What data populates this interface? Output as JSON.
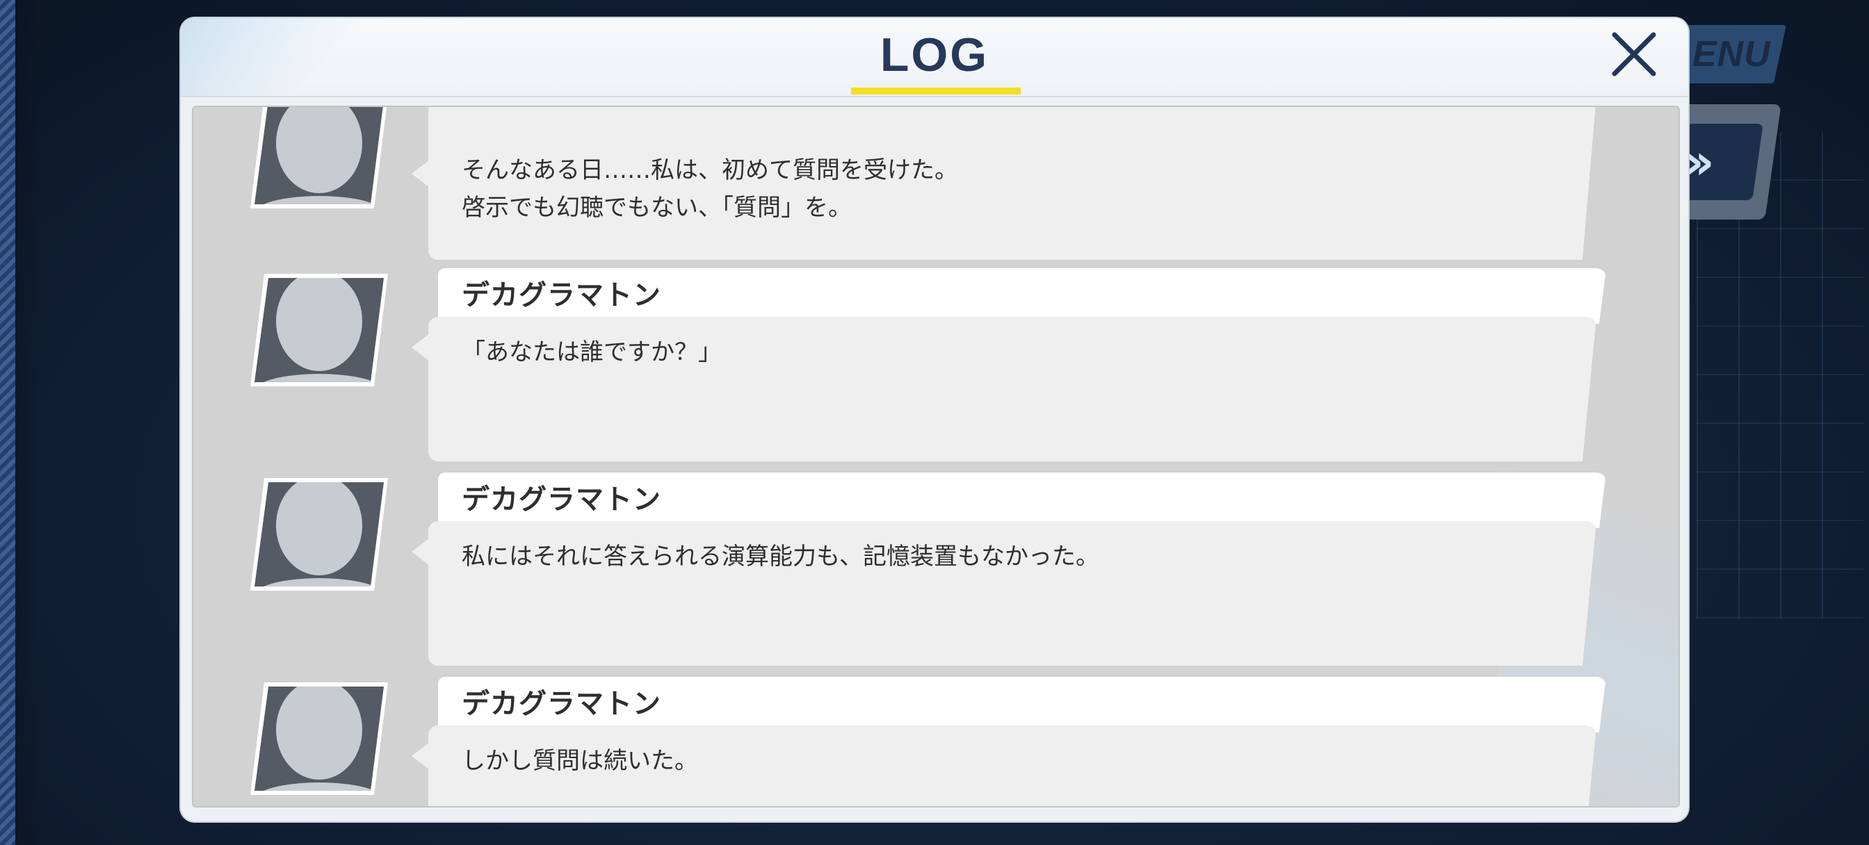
{
  "header": {
    "title": "LOG",
    "accent_color": "#f3df25",
    "close_icon": "close-icon"
  },
  "background": {
    "menu_label": "ENU",
    "skip_icon": "fast-forward-icon"
  },
  "log": {
    "entries": [
      {
        "speaker": "",
        "lines": [
          "そんなある日……私は、初めて質問を受けた。",
          "啓示でも幻聴でもない、「質問」を。"
        ]
      },
      {
        "speaker": "デカグラマトン",
        "lines": [
          "「あなたは誰ですか？」"
        ]
      },
      {
        "speaker": "デカグラマトン",
        "lines": [
          "私にはそれに答えられる演算能力も、記憶装置もなかった。"
        ]
      },
      {
        "speaker": "デカグラマトン",
        "lines": [
          "しかし質問は続いた。"
        ]
      }
    ]
  }
}
